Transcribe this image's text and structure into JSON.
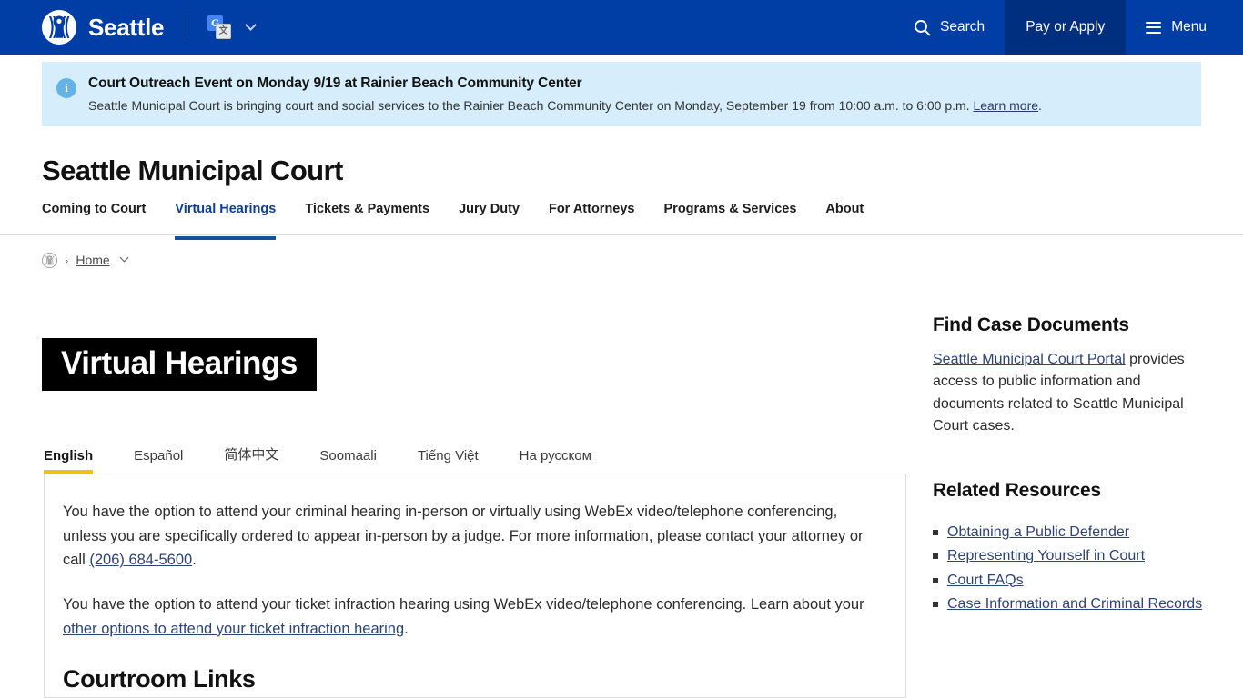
{
  "header": {
    "brand": "Seattle",
    "seal_icon": "seattle-city-seal-icon",
    "translate_icon": "google-translate-icon",
    "translate_g": "G",
    "translate_char": "文",
    "translate_chevron_icon": "chevron-down-icon",
    "search_label": "Search",
    "search_icon": "search-icon",
    "pay_or_apply_label": "Pay or Apply",
    "menu_label": "Menu",
    "menu_icon": "hamburger-menu-icon",
    "background_color": "#003da5",
    "pay_background_color": "#002f80"
  },
  "alert": {
    "icon": "info-circle-icon",
    "icon_glyph": "i",
    "title": "Court Outreach Event on Monday 9/19 at Rainier Beach Community Center",
    "text_before_link": "Seattle Municipal Court is bringing court and social services to the Rainier Beach Community Center on Monday, September 19 from 10:00 a.m. to 6:00 p.m. ",
    "link_label": "Learn more",
    "text_after_link": ".",
    "background_color": "#d6eefb"
  },
  "site": {
    "title": "Seattle Municipal Court",
    "nav": [
      {
        "label": "Coming to Court",
        "active": false
      },
      {
        "label": "Virtual Hearings",
        "active": true
      },
      {
        "label": "Tickets & Payments",
        "active": false
      },
      {
        "label": "Jury Duty",
        "active": false
      },
      {
        "label": "For Attorneys",
        "active": false
      },
      {
        "label": "Programs & Services",
        "active": false
      },
      {
        "label": "About",
        "active": false
      }
    ],
    "active_underline_color": "#14509c"
  },
  "breadcrumb": {
    "seal_icon": "seattle-city-seal-icon",
    "separator": "›",
    "home_label": "Home",
    "chevron_icon": "chevron-down-icon"
  },
  "page": {
    "heading": "Virtual Hearings",
    "heading_background": "#000000"
  },
  "language_tabs": {
    "active_underline_color": "#f2c014",
    "items": [
      {
        "label": "English",
        "active": true
      },
      {
        "label": "Español",
        "active": false
      },
      {
        "label": "简体中文",
        "active": false
      },
      {
        "label": "Soomaali",
        "active": false
      },
      {
        "label": "Tiếng Việt",
        "active": false
      },
      {
        "label": "На русском",
        "active": false
      }
    ]
  },
  "content": {
    "paragraph1_part1": "You have the option to attend your criminal hearing in-person or virtually using WebEx video/telephone conferencing, unless you are specifically ordered to appear in-person by a judge. For more information, please contact your attorney or call ",
    "paragraph1_link": "(206) 684-5600",
    "paragraph1_part2": ".",
    "paragraph2_part1": "You have the option to attend your ticket infraction hearing using WebEx video/telephone conferencing. Learn about your ",
    "paragraph2_link": "other options to attend your ticket infraction hearing",
    "paragraph2_part2": ".",
    "section_heading": "Courtroom Links"
  },
  "sidebar": {
    "find_case_documents": {
      "heading": "Find Case Documents",
      "link_label": "Seattle Municipal Court Portal",
      "text": " provides access to public information and documents related to Seattle Municipal Court cases."
    },
    "related_resources": {
      "heading": "Related Resources",
      "links": [
        "Obtaining a Public Defender",
        "Representing Yourself in Court",
        "Court FAQs",
        "Case Information and Criminal Records"
      ]
    }
  }
}
